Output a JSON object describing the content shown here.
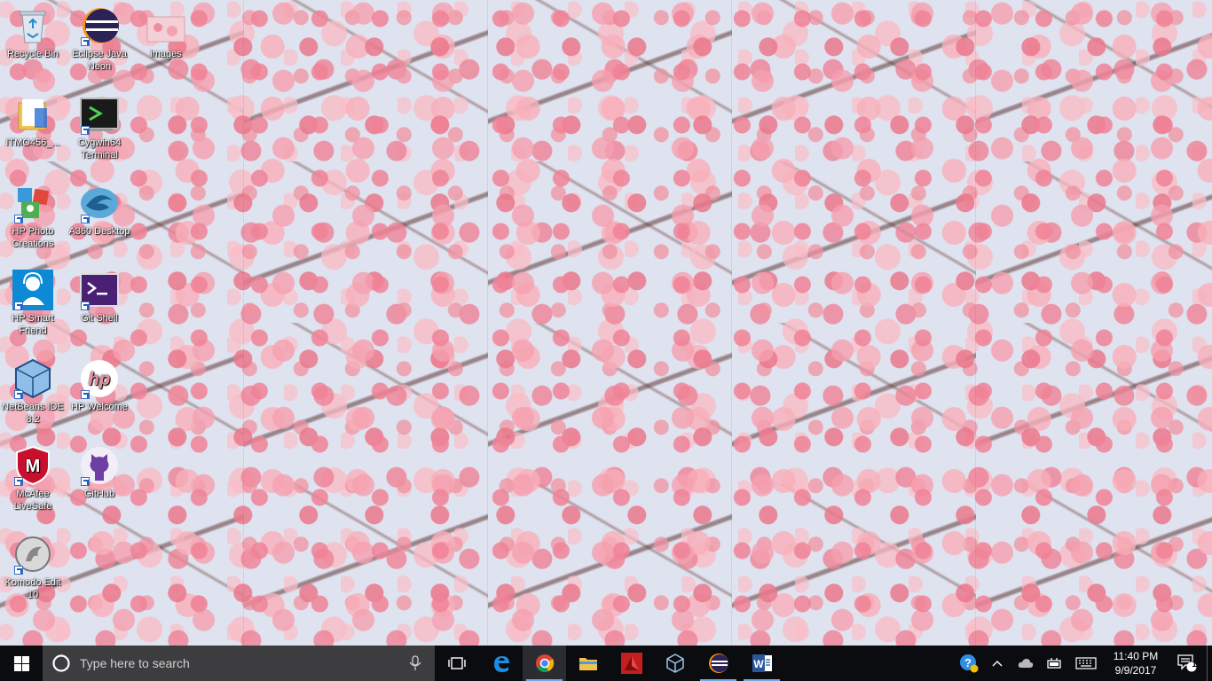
{
  "desktop": {
    "icons": [
      {
        "label": "Recycle Bin"
      },
      {
        "label": "Eclipse Java Neon"
      },
      {
        "label": "images"
      },
      {
        "label": "ITMO456_..."
      },
      {
        "label": "Cygwin64 Terminal"
      },
      {
        "label": "HP Photo Creations"
      },
      {
        "label": "A360 Desktop"
      },
      {
        "label": "HP Smart Friend"
      },
      {
        "label": "Git Shell"
      },
      {
        "label": "NetBeans IDE 8.2"
      },
      {
        "label": "HP Welcome"
      },
      {
        "label": "McAfee LiveSafe"
      },
      {
        "label": "GitHub"
      },
      {
        "label": "Komodo Edit 10"
      }
    ]
  },
  "taskbar": {
    "search_placeholder": "Type here to search",
    "pinned": [
      "edge-icon",
      "chrome-icon",
      "file-explorer-icon",
      "autodesk-icon",
      "virtualbox-icon",
      "eclipse-icon",
      "word-icon"
    ],
    "clock": {
      "time": "11:40 PM",
      "date": "9/9/2017"
    },
    "notification_count": "1"
  }
}
